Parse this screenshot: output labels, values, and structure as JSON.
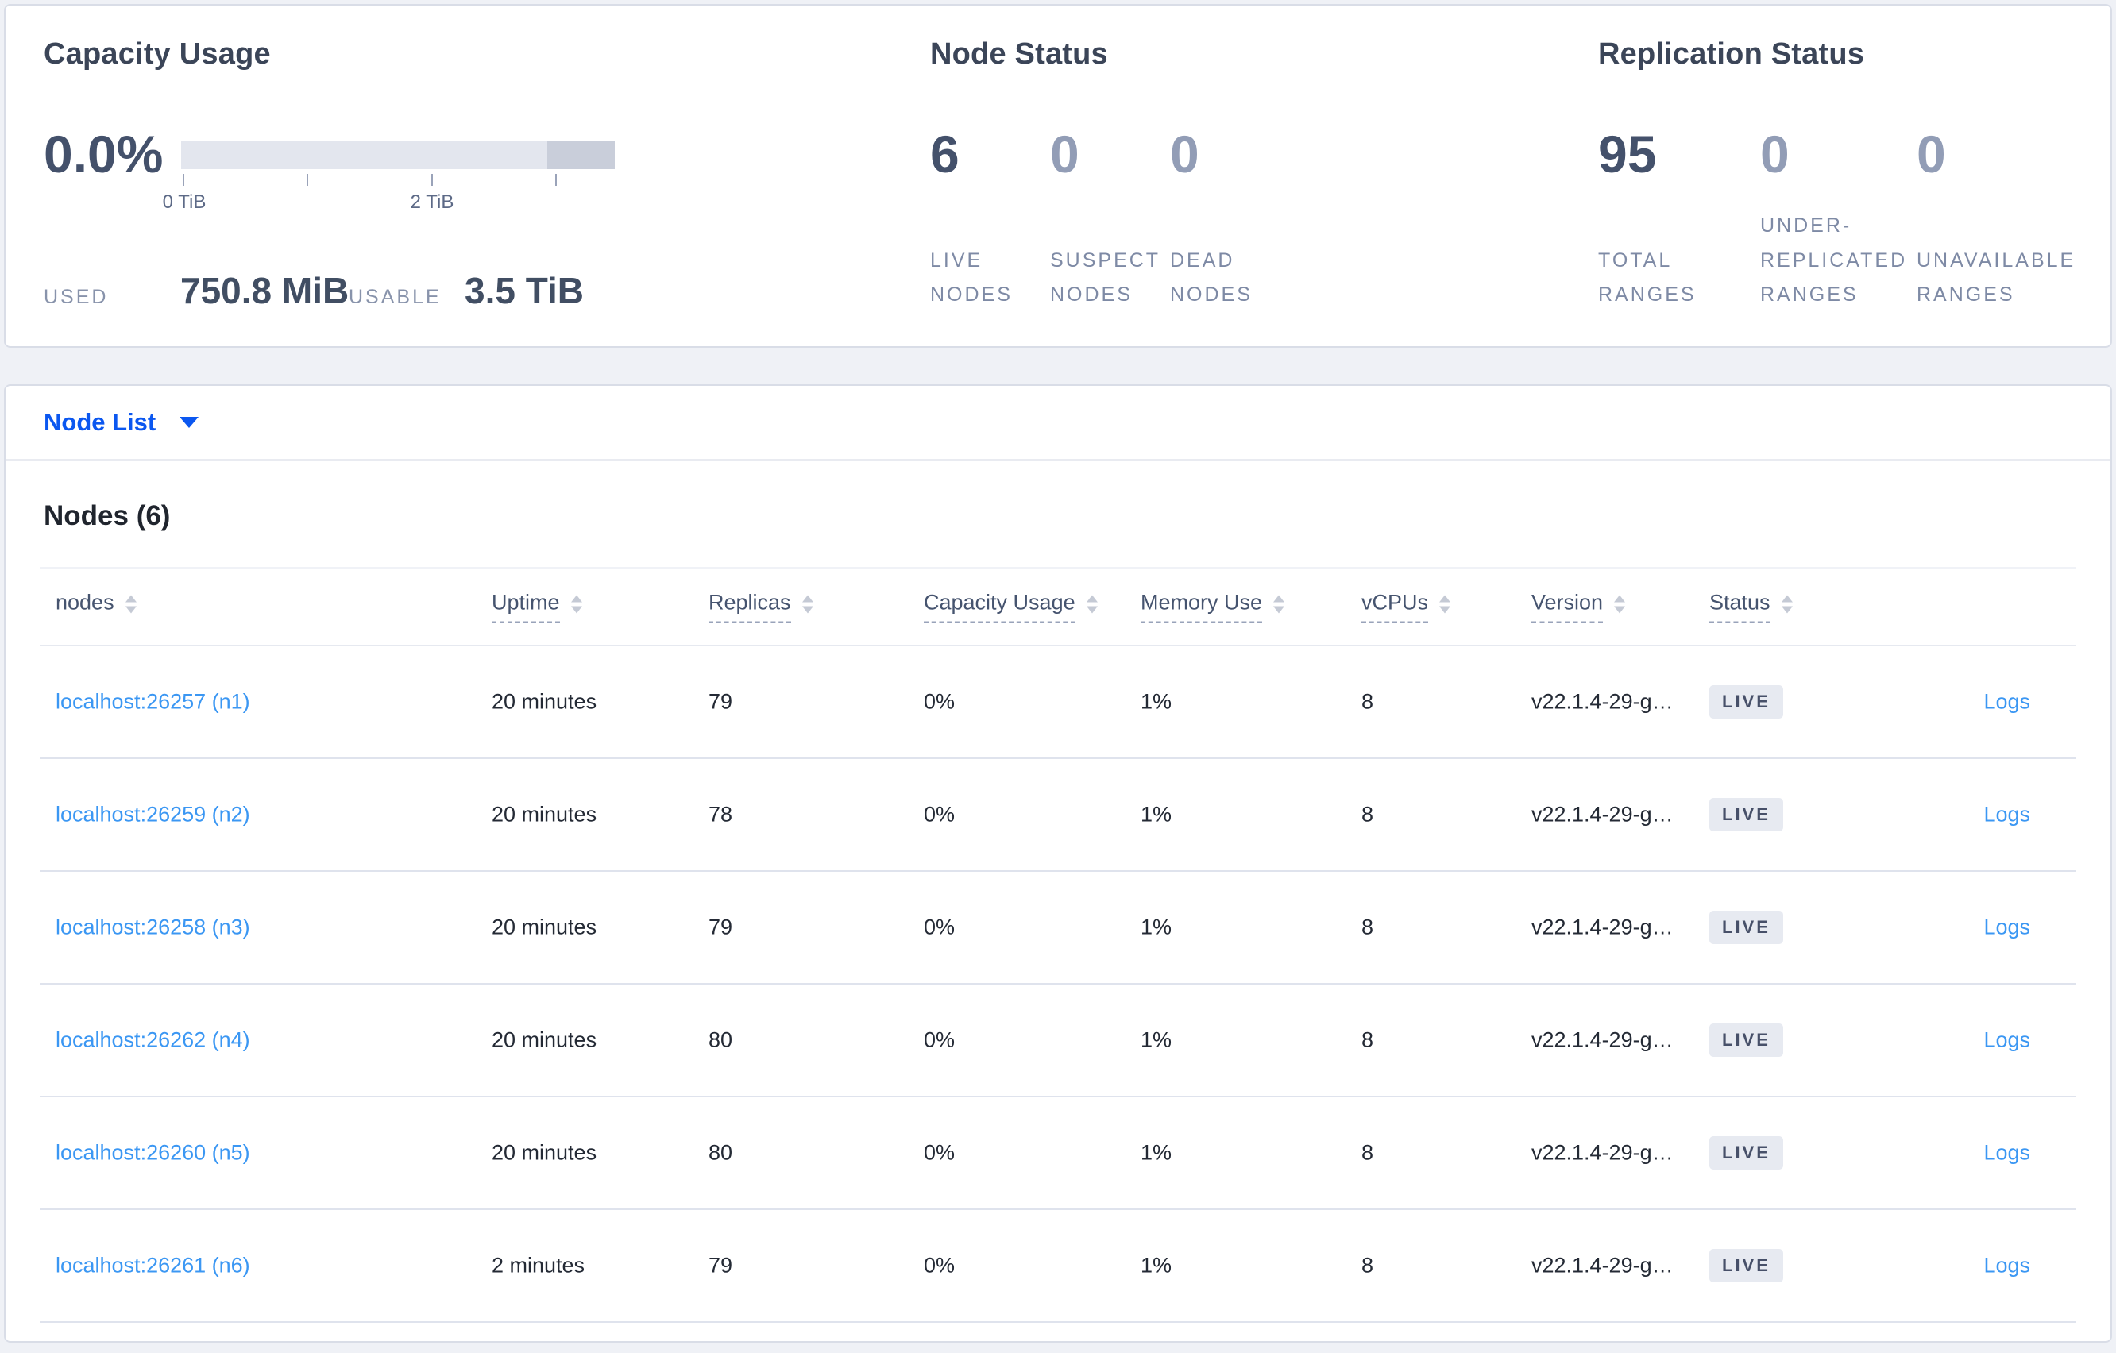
{
  "summary": {
    "capacity": {
      "title": "Capacity Usage",
      "percent_used": "0.0%",
      "tick_labels": [
        "0 TiB",
        "2 TiB"
      ],
      "used_label": "USED",
      "used_value": "750.8 MiB",
      "usable_label": "USABLE",
      "usable_value": "3.5 TiB"
    },
    "node_status": {
      "title": "Node Status",
      "metrics": [
        {
          "value": "6",
          "label": "LIVE NODES"
        },
        {
          "value": "0",
          "label": "SUSPECT NODES"
        },
        {
          "value": "0",
          "label": "DEAD NODES"
        }
      ]
    },
    "replication_status": {
      "title": "Replication Status",
      "metrics": [
        {
          "value": "95",
          "label": "TOTAL RANGES"
        },
        {
          "value": "0",
          "label": "UNDER-REPLICATED RANGES"
        },
        {
          "value": "0",
          "label": "UNAVAILABLE RANGES"
        }
      ]
    }
  },
  "view_selector": {
    "label": "Node List"
  },
  "nodes_table": {
    "heading": "Nodes (6)",
    "columns": [
      {
        "label": "nodes"
      },
      {
        "label": "Uptime"
      },
      {
        "label": "Replicas"
      },
      {
        "label": "Capacity Usage"
      },
      {
        "label": "Memory Use"
      },
      {
        "label": "vCPUs"
      },
      {
        "label": "Version"
      },
      {
        "label": "Status"
      }
    ],
    "rows": [
      {
        "node": "localhost:26257 (n1)",
        "uptime": "20 minutes",
        "replicas": "79",
        "capacity_usage": "0%",
        "memory_use": "1%",
        "vcpus": "8",
        "version": "v22.1.4-29-g…",
        "status": "LIVE",
        "logs": "Logs"
      },
      {
        "node": "localhost:26259 (n2)",
        "uptime": "20 minutes",
        "replicas": "78",
        "capacity_usage": "0%",
        "memory_use": "1%",
        "vcpus": "8",
        "version": "v22.1.4-29-g…",
        "status": "LIVE",
        "logs": "Logs"
      },
      {
        "node": "localhost:26258 (n3)",
        "uptime": "20 minutes",
        "replicas": "79",
        "capacity_usage": "0%",
        "memory_use": "1%",
        "vcpus": "8",
        "version": "v22.1.4-29-g…",
        "status": "LIVE",
        "logs": "Logs"
      },
      {
        "node": "localhost:26262 (n4)",
        "uptime": "20 minutes",
        "replicas": "80",
        "capacity_usage": "0%",
        "memory_use": "1%",
        "vcpus": "8",
        "version": "v22.1.4-29-g…",
        "status": "LIVE",
        "logs": "Logs"
      },
      {
        "node": "localhost:26260 (n5)",
        "uptime": "20 minutes",
        "replicas": "80",
        "capacity_usage": "0%",
        "memory_use": "1%",
        "vcpus": "8",
        "version": "v22.1.4-29-g…",
        "status": "LIVE",
        "logs": "Logs"
      },
      {
        "node": "localhost:26261 (n6)",
        "uptime": "2 minutes",
        "replicas": "79",
        "capacity_usage": "0%",
        "memory_use": "1%",
        "vcpus": "8",
        "version": "v22.1.4-29-g…",
        "status": "LIVE",
        "logs": "Logs"
      }
    ]
  },
  "colors": {
    "accent_blue": "#0b57f0",
    "link_blue": "#3b97f3",
    "title_slate": "#3b4558",
    "metric_primary": "#44516b",
    "metric_muted": "#929db6",
    "label_gray": "#7e8aa5",
    "badge_bg": "#e7eaf1",
    "badge_text": "#475069",
    "bar_light": "#e3e6ee",
    "bar_dark": "#c9ceda",
    "page_bg": "#eff1f6"
  }
}
